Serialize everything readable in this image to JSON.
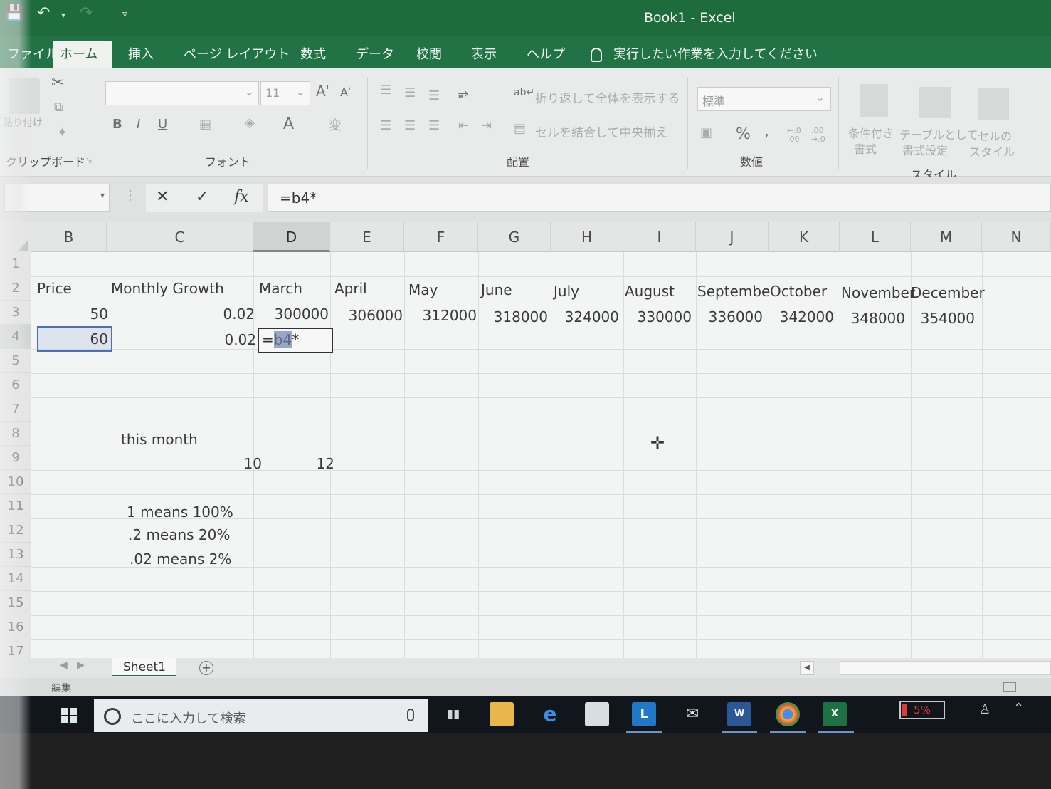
{
  "window": {
    "title": "Book1  -  Excel"
  },
  "tabs": {
    "file": "ファイル",
    "home": "ホーム",
    "insert": "挿入",
    "page_layout": "ページ レイアウト",
    "formulas": "数式",
    "data": "データ",
    "review": "校閲",
    "view": "表示",
    "help": "ヘルプ",
    "tell_me": "実行したい作業を入力してください"
  },
  "ribbon": {
    "groups": {
      "clipboard": "クリップボード",
      "font": "フォント",
      "alignment": "配置",
      "number": "数値",
      "styles": "スタイル"
    },
    "paste_label": "貼り付け",
    "font_size": "11",
    "bold": "B",
    "italic": "I",
    "underline": "U",
    "wrap_text": "折り返して全体を表示する",
    "merge_center": "セルを結合して中央揃え",
    "number_format": "標準",
    "percent": "%",
    "comma": ",",
    "cond_format": "条件付き",
    "cond_format_2": "書式",
    "format_table": "テーブルとして",
    "format_table_2": "書式設定",
    "cell_styles": "セルの",
    "cell_styles_2": "スタイル"
  },
  "formula_bar": {
    "cancel": "✕",
    "enter": "✓",
    "fx": "fx",
    "content": "=b4*"
  },
  "columns": [
    "B",
    "C",
    "D",
    "E",
    "F",
    "G",
    "H",
    "I",
    "J",
    "K",
    "L",
    "M",
    "N"
  ],
  "rows": [
    "1",
    "2",
    "3",
    "4",
    "5",
    "6",
    "7",
    "8",
    "9",
    "10",
    "11",
    "12",
    "13",
    "14",
    "15",
    "16",
    "17"
  ],
  "cells": {
    "B2": "Price",
    "C2": "Monthly Growth",
    "D2": "March",
    "E2": "April",
    "F2": "May",
    "G2": "June",
    "H2": "July",
    "I2": "August",
    "J2": "Septembe",
    "K2": "October",
    "L2": "November",
    "M2": "December",
    "B3": "50",
    "C3": "0.02",
    "D3": "300000",
    "E3": "306000",
    "F3": "312000",
    "G3": "318000",
    "H3": "324000",
    "I3": "330000",
    "J3": "336000",
    "K3": "342000",
    "L3": "348000",
    "M3": "354000",
    "B4": "60",
    "C4": "0.02",
    "D4_prefix": "=",
    "D4_ref": "b4",
    "D4_suffix": "*",
    "C8": "this month",
    "C9": "10",
    "D9": "12",
    "C11": "1 means 100%",
    "C12": ".2 means 20%",
    "C13": ".02 means 2%"
  },
  "sheet": {
    "tab": "Sheet1",
    "add": "+"
  },
  "status": {
    "mode": "編集"
  },
  "taskbar": {
    "search_placeholder": "ここに入力して検索",
    "battery": "5%",
    "app_l": "L",
    "app_word": "W",
    "app_excel": "X"
  }
}
